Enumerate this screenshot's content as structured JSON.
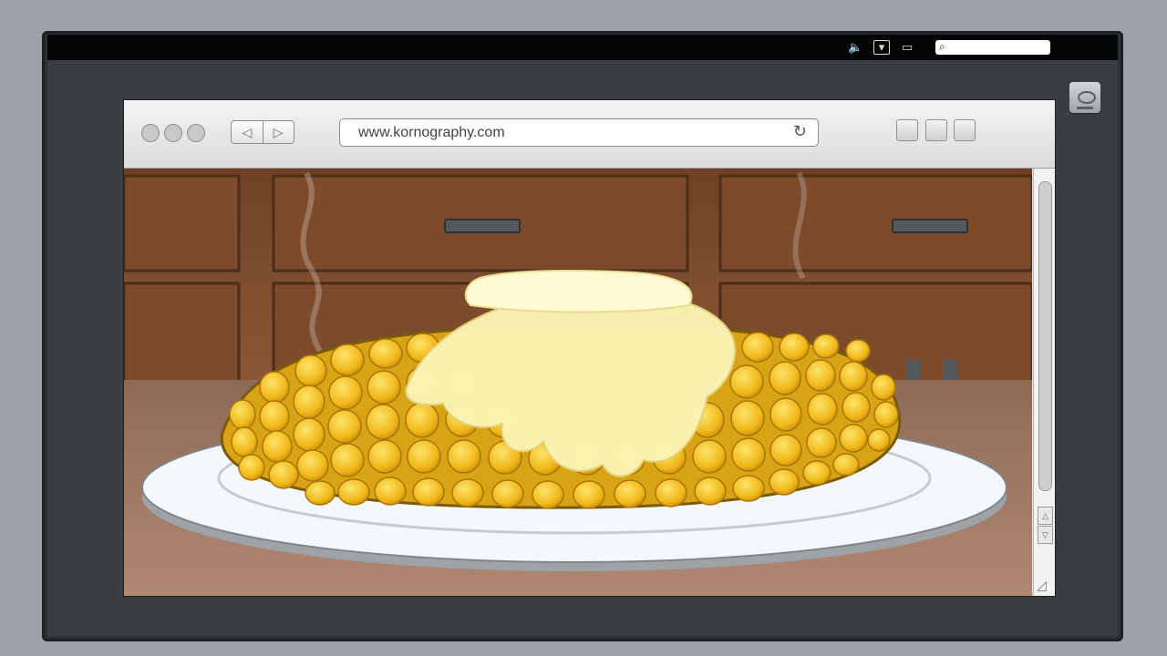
{
  "browser": {
    "url": "www.kornography.com",
    "back_icon": "◁",
    "forward_icon": "▷",
    "reload_icon": "↻"
  },
  "menubar": {
    "volume_icon": "🔈",
    "dropdown_icon": "▾",
    "window_icon": "▭",
    "search_icon": "⌕"
  },
  "scrollbar": {
    "up_icon": "△",
    "down_icon": "▽",
    "resize_icon": "◿"
  },
  "colors": {
    "wood": "#7a4a2c",
    "corn": "#f2c21a",
    "butter": "#fbf3b2",
    "plate": "#f4f8fa",
    "desktop": "#373d40"
  }
}
